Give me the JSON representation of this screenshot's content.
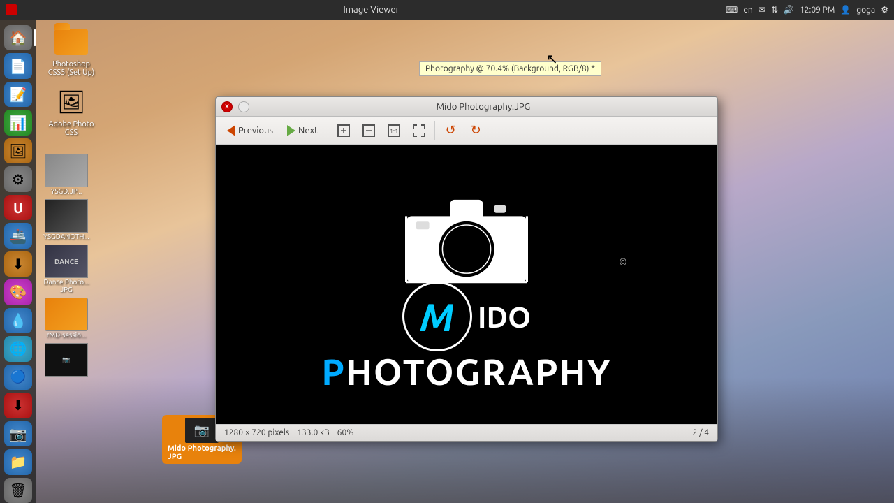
{
  "taskbar": {
    "title": "Image Viewer",
    "keyboard": "en",
    "time": "12:09 PM",
    "user": "goga"
  },
  "sidebar": {
    "items": [
      {
        "id": "home",
        "icon": "🏠",
        "class": "si-home"
      },
      {
        "id": "files",
        "icon": "📄",
        "class": "si-doc"
      },
      {
        "id": "text",
        "icon": "📝",
        "class": "si-txt"
      },
      {
        "id": "sheet",
        "icon": "📊",
        "class": "si-sheet"
      },
      {
        "id": "psd",
        "icon": "🖼",
        "class": "si-psd"
      },
      {
        "id": "gear",
        "icon": "⚙",
        "class": "si-gear"
      },
      {
        "id": "u",
        "icon": "U",
        "class": "si-u"
      },
      {
        "id": "ship",
        "icon": "🚢",
        "class": "si-ship"
      },
      {
        "id": "dl",
        "icon": "⬇",
        "class": "si-dl"
      },
      {
        "id": "color",
        "icon": "🎨",
        "class": "si-color"
      },
      {
        "id": "drop",
        "icon": "💧",
        "class": "si-drop"
      },
      {
        "id": "globe",
        "icon": "🌐",
        "class": "si-globe"
      },
      {
        "id": "chrome",
        "icon": "🔵",
        "class": "si-chrome"
      },
      {
        "id": "dl2",
        "icon": "⬇",
        "class": "si-dl2"
      },
      {
        "id": "cam",
        "icon": "📷",
        "class": "si-cam"
      },
      {
        "id": "files2",
        "icon": "📁",
        "class": "si-files"
      },
      {
        "id": "trash",
        "icon": "🗑",
        "class": "si-trash"
      }
    ]
  },
  "desktop_icons": [
    {
      "id": "photoshop-css",
      "label": "Photoshop CSS5 (Set Up)",
      "type": "folder"
    },
    {
      "id": "adobe-photoshop",
      "label": "Adobe Photo CSS",
      "type": "app"
    }
  ],
  "thumbnails": [
    {
      "id": "ysgd",
      "label": "YSGD.JP...",
      "color": "#888"
    },
    {
      "id": "ysgdanoth",
      "label": "YSGDANOTH...",
      "color": "#333"
    },
    {
      "id": "dance",
      "label": "Dance Photo... JPG",
      "color": "#444"
    },
    {
      "id": "rmd",
      "label": "rMD-sessio...",
      "type": "folder"
    },
    {
      "id": "mido-bottom",
      "label": "Mido Photography. JPG",
      "type": "selected"
    }
  ],
  "tooltip": {
    "text": "Photography @ 70.4% (Background, RGB/8) *"
  },
  "viewer": {
    "title": "Mido Photography.JPG",
    "toolbar": {
      "previous": "Previous",
      "next": "Next"
    },
    "statusbar": {
      "dimensions": "1280 × 720 pixels",
      "filesize": "133.0 kB",
      "zoom": "60%",
      "position": "2 / 4"
    },
    "logo": {
      "m_letter": "M",
      "ido": "IDO",
      "p_letter": "P",
      "hotography": "HOTOGRAPHY",
      "copyright": "©"
    }
  }
}
